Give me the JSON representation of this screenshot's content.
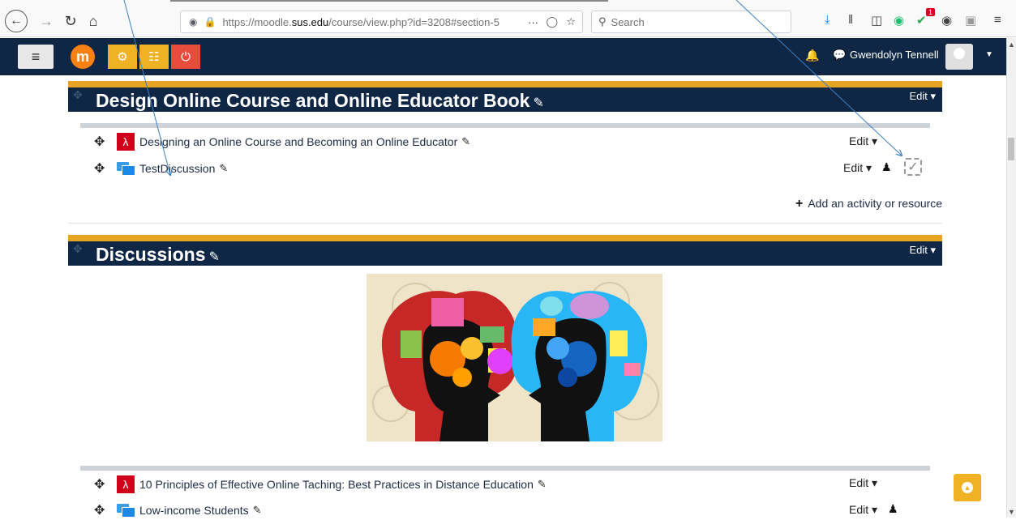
{
  "browser": {
    "url_prefix": "https://moodle.",
    "url_domain": "sus.edu",
    "url_path": "/course/view.php?id=3208#section-5",
    "search_placeholder": "Search",
    "ellipsis": "···",
    "badge_count": "1"
  },
  "navbar": {
    "user_name": "Gwendolyn Tennell",
    "logo_letter": "m",
    "tile_colors": [
      "#f0b124",
      "#f0b124",
      "#e74c3c"
    ]
  },
  "sections": [
    {
      "title": "Design Online Course and Online Educator Book",
      "edit_label": "Edit",
      "activities": [
        {
          "name": "Designing an Online Course and Becoming an Online Educator",
          "type": "pdf",
          "edit_label": "Edit"
        },
        {
          "name": "TestDiscussion",
          "type": "forum",
          "edit_label": "Edit"
        }
      ],
      "add_label": "Add an activity or resource"
    },
    {
      "title": "Discussions",
      "edit_label": "Edit",
      "activities": [
        {
          "name": "10 Principles of Effective Online Taching: Best Practices in Distance Education",
          "type": "pdf",
          "edit_label": "Edit"
        },
        {
          "name": "Low-income Students",
          "type": "forum",
          "edit_label": "Edit"
        }
      ]
    }
  ],
  "colors": {
    "navy": "#0f2744",
    "gold": "#e8a524",
    "pdf_red": "#d0021b",
    "forum_blue": "#1e88e5"
  }
}
